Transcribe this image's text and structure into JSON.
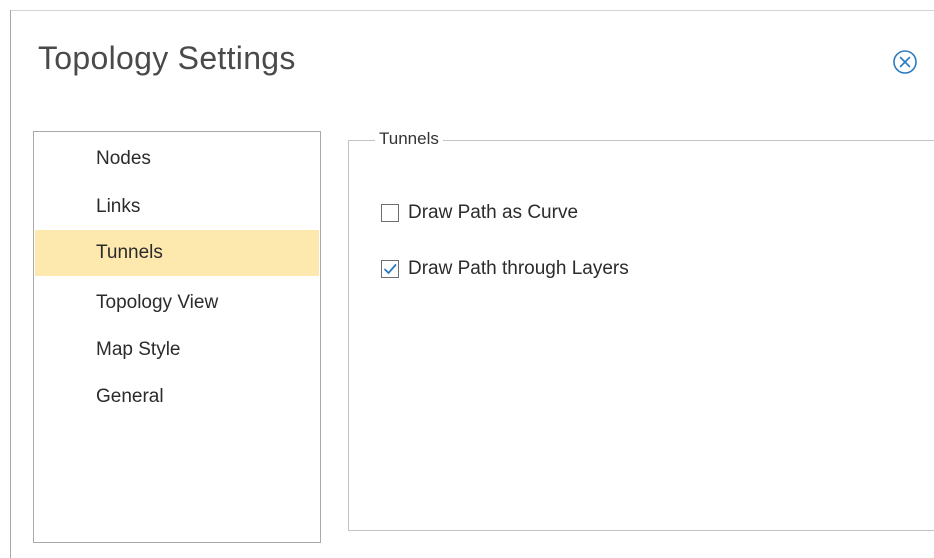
{
  "dialog": {
    "title": "Topology Settings",
    "close_icon": "close-circle-icon"
  },
  "sidebar": {
    "selected": "Tunnels",
    "items": [
      {
        "label": "Nodes"
      },
      {
        "label": "Links"
      },
      {
        "label": "Tunnels"
      },
      {
        "label": "Topology View"
      },
      {
        "label": "Map Style"
      },
      {
        "label": "General"
      }
    ]
  },
  "panel": {
    "legend": "Tunnels",
    "options": [
      {
        "label": "Draw Path as Curve",
        "checked": false
      },
      {
        "label": "Draw Path through Layers",
        "checked": true
      }
    ]
  },
  "colors": {
    "accent": "#2b7bc0",
    "selection": "#fde8ae"
  }
}
